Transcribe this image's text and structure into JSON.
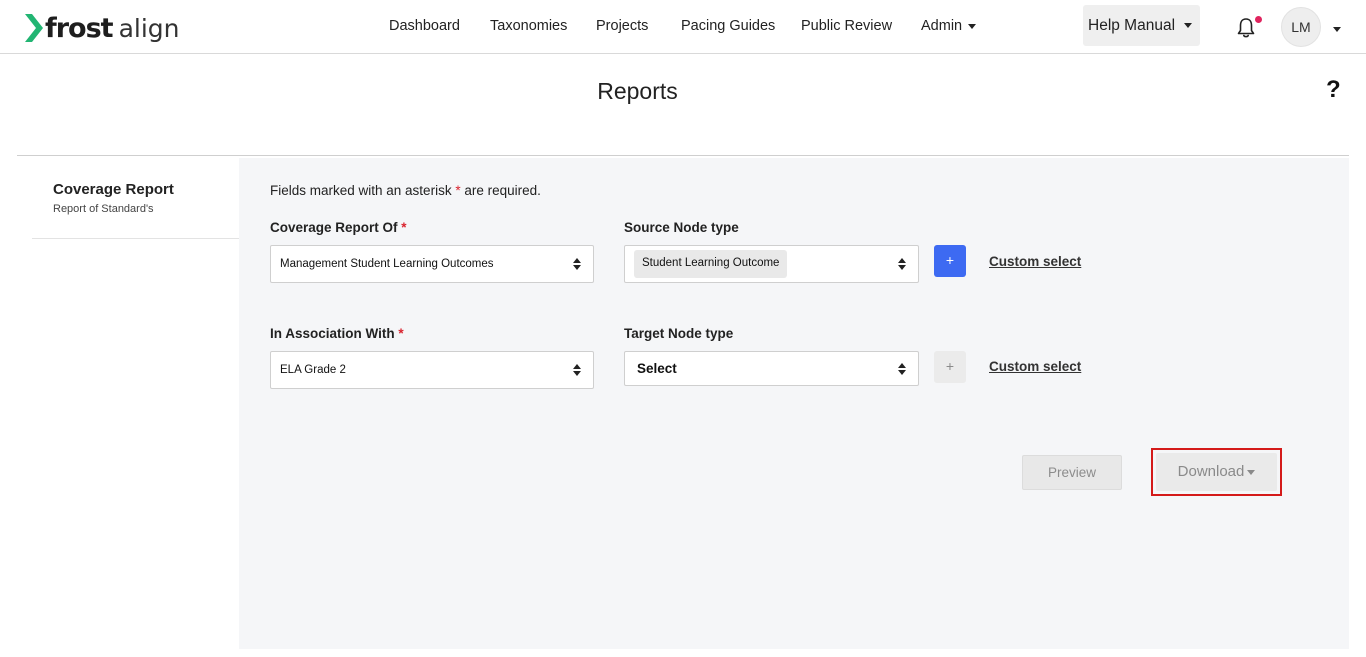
{
  "brand": {
    "name_bold": "frost",
    "name_light": "align",
    "accent_color": "#22b573"
  },
  "nav": {
    "items": [
      {
        "label": "Dashboard"
      },
      {
        "label": "Taxonomies"
      },
      {
        "label": "Projects"
      },
      {
        "label": "Pacing Guides"
      },
      {
        "label": "Public Review"
      },
      {
        "label": "Admin"
      }
    ],
    "help_manual": "Help Manual",
    "avatar_initials": "LM",
    "notification_icon": "bell-icon"
  },
  "page": {
    "title": "Reports",
    "help_icon_label": "?"
  },
  "sidebar": {
    "card_title": "Coverage Report",
    "card_subtitle": "Report of Standard's"
  },
  "form": {
    "required_note_before": "Fields marked with an asterisk",
    "required_note_after": "are required.",
    "asterisk": "*",
    "coverage_report_of": {
      "label": "Coverage Report Of",
      "value": "Management Student Learning Outcomes"
    },
    "source_node_type": {
      "label": "Source Node type",
      "value": "Student Learning Outcome"
    },
    "in_association_with": {
      "label": "In Association With",
      "value": "ELA Grade 2"
    },
    "target_node_type": {
      "label": "Target Node type",
      "value": "Select"
    },
    "add_label": "+",
    "custom_select": "Custom select"
  },
  "actions": {
    "preview": "Preview",
    "download": "Download"
  },
  "colors": {
    "primary_blue": "#3d6af2",
    "required_red": "#d9232e",
    "highlight_red": "#d41a1a"
  }
}
